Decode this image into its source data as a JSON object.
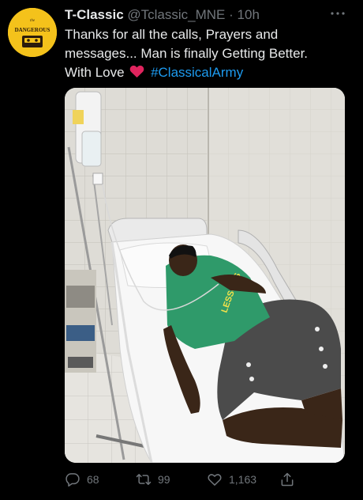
{
  "tweet": {
    "display_name": "T-Classic",
    "handle": "@Tclassic_MNE",
    "separator": "·",
    "time": "10h",
    "more_icon": "more-icon",
    "text_line1": "Thanks for all the calls, Prayers and",
    "text_line2": "messages... Man is finally Getting Better.",
    "text_line3": "With Love",
    "hashtag": "#ClassicalArmy",
    "avatar_text": "DANGEROUS",
    "media_shirt_text": "LESSONS",
    "colors": {
      "background": "#000000",
      "text": "#e7e9ea",
      "muted": "#71767b",
      "link": "#1d9bf0",
      "heart": "#f91880",
      "avatar": "#f4c21b"
    }
  },
  "actions": {
    "reply_count": "68",
    "retweet_count": "99",
    "like_count": "1,163"
  }
}
